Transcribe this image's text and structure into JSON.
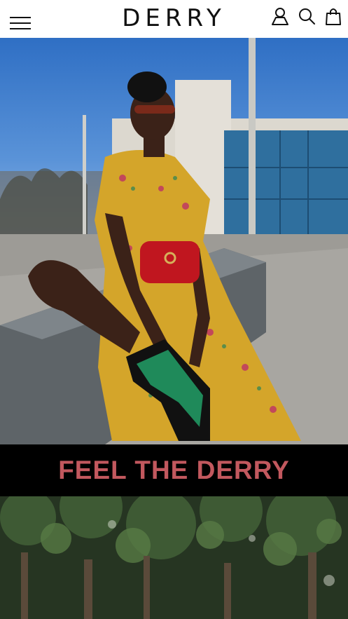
{
  "header": {
    "brand": "DERRY",
    "icons": [
      "menu-icon",
      "account-icon",
      "search-icon",
      "shopping-bag-icon"
    ]
  },
  "hero": {
    "image": "fashion-model-photo"
  },
  "banner": {
    "text": "FEEL THE DERRY",
    "background": "#000000",
    "text_color": "#c2585e"
  },
  "secondary_section": {
    "image": "foliage-photo"
  }
}
